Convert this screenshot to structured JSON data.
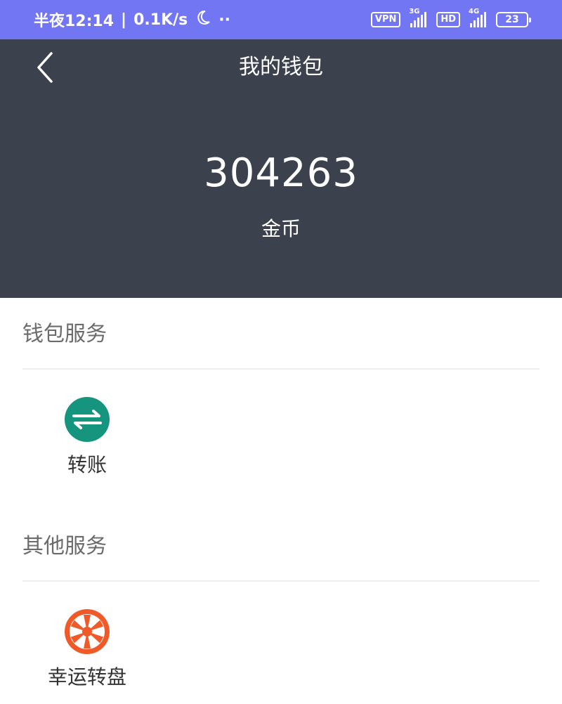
{
  "status_bar": {
    "time": "半夜12:14",
    "separator": "|",
    "speed": "0.1K/s",
    "moon_icon": "moon-icon",
    "dots": "··",
    "vpn": "VPN",
    "sim1_type": "3G",
    "hd": "HD",
    "sim2_type": "4G",
    "battery": "23"
  },
  "header": {
    "title": "我的钱包",
    "back_icon": "chevron-left-icon"
  },
  "wallet": {
    "amount": "304263",
    "unit_label": "金币"
  },
  "sections": {
    "wallet_services": {
      "heading": "钱包服务",
      "items": [
        {
          "label": "转账",
          "icon": "transfer-icon",
          "color": "#15947e"
        }
      ]
    },
    "other_services": {
      "heading": "其他服务",
      "items": [
        {
          "label": "幸运转盘",
          "icon": "lucky-wheel-icon",
          "color": "#f05a28"
        }
      ]
    }
  },
  "colors": {
    "status_bar": "#7276f2",
    "header_bg": "#3b414d"
  }
}
